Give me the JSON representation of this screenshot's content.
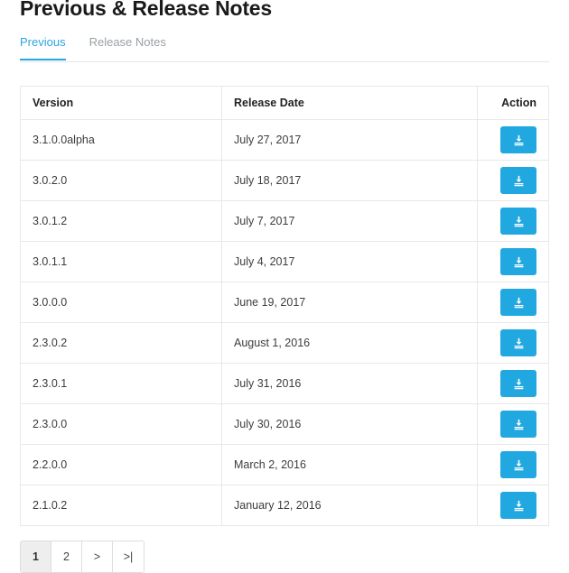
{
  "header": {
    "title": "Previous & Release Notes"
  },
  "tabs": [
    {
      "label": "Previous",
      "active": true
    },
    {
      "label": "Release Notes",
      "active": false
    }
  ],
  "table": {
    "columns": [
      {
        "label": "Version",
        "align": "left"
      },
      {
        "label": "Release Date",
        "align": "left"
      },
      {
        "label": "Action",
        "align": "right"
      }
    ],
    "rows": [
      {
        "version": "3.1.0.0alpha",
        "release_date": "July 27, 2017",
        "action_icon": "download-icon"
      },
      {
        "version": "3.0.2.0",
        "release_date": "July 18, 2017",
        "action_icon": "download-icon"
      },
      {
        "version": "3.0.1.2",
        "release_date": "July 7, 2017",
        "action_icon": "download-icon"
      },
      {
        "version": "3.0.1.1",
        "release_date": "July 4, 2017",
        "action_icon": "download-icon"
      },
      {
        "version": "3.0.0.0",
        "release_date": "June 19, 2017",
        "action_icon": "download-icon"
      },
      {
        "version": "2.3.0.2",
        "release_date": "August 1, 2016",
        "action_icon": "download-icon"
      },
      {
        "version": "2.3.0.1",
        "release_date": "July 31, 2016",
        "action_icon": "download-icon"
      },
      {
        "version": "2.3.0.0",
        "release_date": "July 30, 2016",
        "action_icon": "download-icon"
      },
      {
        "version": "2.2.0.0",
        "release_date": "March 2, 2016",
        "action_icon": "download-icon"
      },
      {
        "version": "2.1.0.2",
        "release_date": "January 12, 2016",
        "action_icon": "download-icon"
      }
    ]
  },
  "pagination": [
    {
      "label": "1",
      "active": true,
      "name": "page-1"
    },
    {
      "label": "2",
      "active": false,
      "name": "page-2"
    },
    {
      "label": ">",
      "active": false,
      "name": "page-next"
    },
    {
      "label": ">|",
      "active": false,
      "name": "page-last"
    }
  ],
  "colors": {
    "accent": "#2ba6df",
    "button": "#22a8e0",
    "border": "#e8e8e8",
    "muted_text": "#9aa0a6",
    "active_page_bg": "#eeeeee"
  }
}
